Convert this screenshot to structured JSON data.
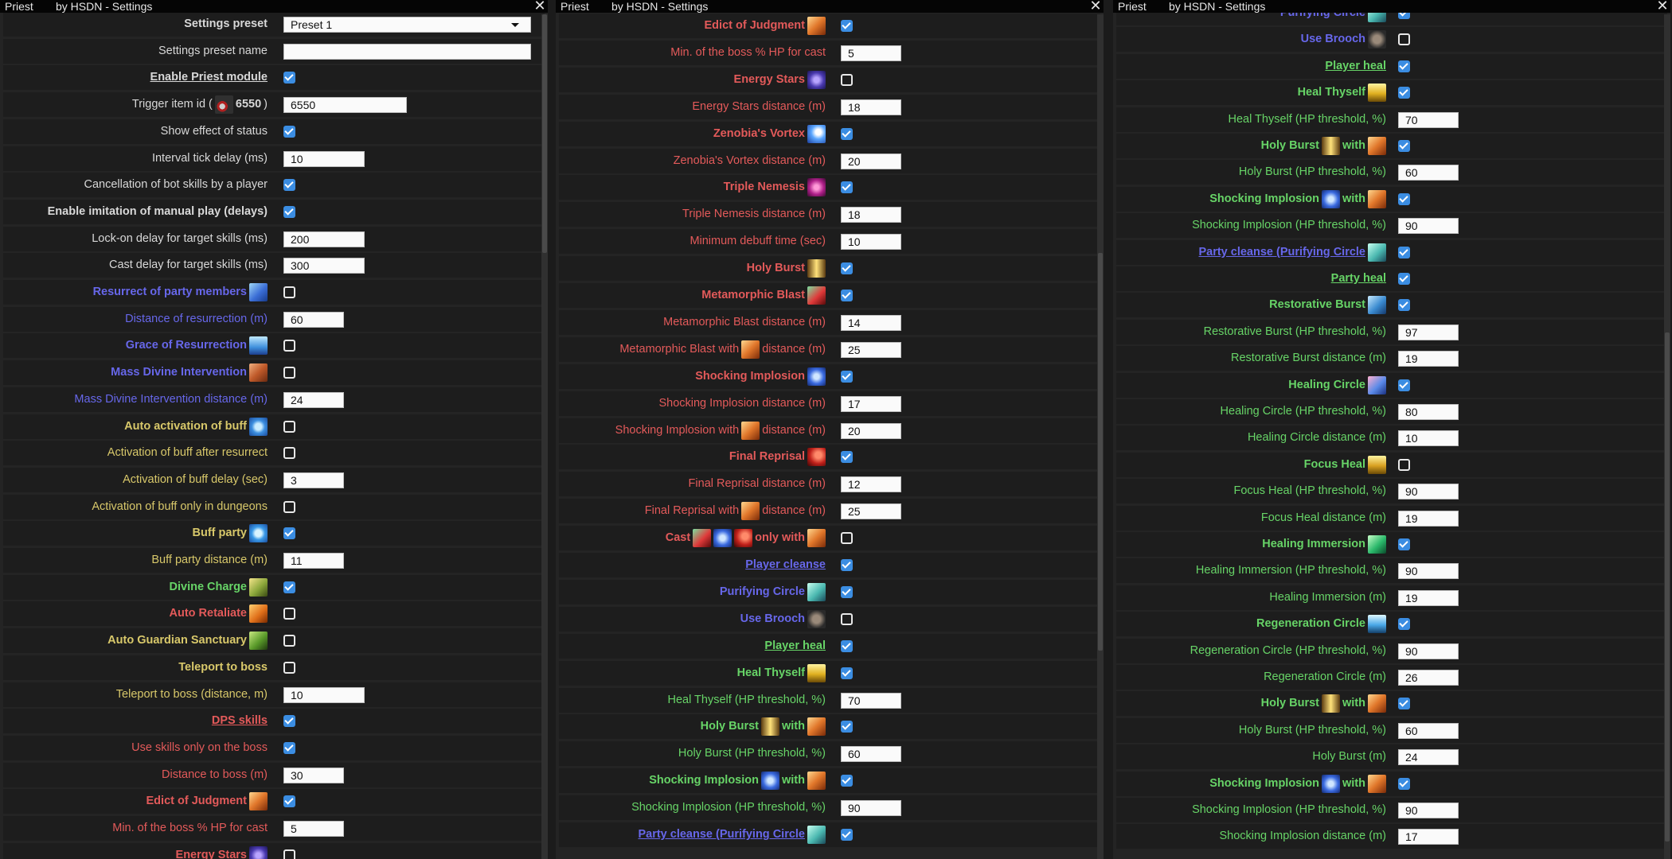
{
  "panels": [
    {
      "title": "Priest",
      "subtitle": "by HSDN - Settings",
      "rows": [
        {
          "label": "Settings preset",
          "color": "w",
          "bold": true,
          "select": "Preset 1"
        },
        {
          "label": "Settings preset name",
          "color": "w",
          "input": ""
        },
        {
          "label": "Enable Priest module",
          "color": "w",
          "bold": true,
          "underline": true,
          "check": true
        },
        {
          "label": "Trigger item id (",
          "color": "w",
          "icons": [
            "item-icon"
          ],
          "after": "6550)",
          "after_bold": "6550",
          "input": "6550"
        },
        {
          "label": "Show effect of status",
          "color": "w",
          "check": true
        },
        {
          "label": "Interval tick delay (ms)",
          "color": "w",
          "input": "10"
        },
        {
          "label": "Cancellation of bot skills by a player",
          "color": "w",
          "check": true
        },
        {
          "label": "Enable imitation of manual play (delays)",
          "color": "w",
          "bold": true,
          "check": true
        },
        {
          "label": "Lock-on delay for target skills (ms)",
          "color": "w",
          "input": "200"
        },
        {
          "label": "Cast delay for target skills (ms)",
          "color": "w",
          "input": "300"
        },
        {
          "label": "Resurrect of party members",
          "color": "b",
          "bold": true,
          "icons": [
            "resurrect-icon"
          ],
          "check": false
        },
        {
          "label": "Distance of resurrection (m)",
          "color": "b",
          "input": "60"
        },
        {
          "label": "Grace of Resurrection",
          "color": "b",
          "bold": true,
          "icons": [
            "grace-resurrection-icon"
          ],
          "check": false
        },
        {
          "label": "Mass Divine Intervention",
          "color": "b",
          "bold": true,
          "icons": [
            "mass-divine-intervention-icon"
          ],
          "check": false
        },
        {
          "label": "Mass Divine Intervention distance (m)",
          "color": "b",
          "input": "24"
        },
        {
          "label": "Auto activation of buff",
          "color": "y",
          "bold": true,
          "icons": [
            "buff-icon"
          ],
          "check": false
        },
        {
          "label": "Activation of buff after resurrect",
          "color": "y",
          "check": false
        },
        {
          "label": "Activation of buff delay (sec)",
          "color": "y",
          "input": "3"
        },
        {
          "label": "Activation of buff only in dungeons",
          "color": "y",
          "check": false
        },
        {
          "label": "Buff party",
          "color": "y",
          "bold": true,
          "icons": [
            "buff-party-icon"
          ],
          "check": true
        },
        {
          "label": "Buff party distance (m)",
          "color": "y",
          "input": "11"
        },
        {
          "label": "Divine Charge",
          "color": "g",
          "bold": true,
          "icons": [
            "divine-charge-icon"
          ],
          "check": true
        },
        {
          "label": "Auto Retaliate",
          "color": "r",
          "bold": true,
          "icons": [
            "auto-retaliate-icon"
          ],
          "check": false
        },
        {
          "label": "Auto Guardian Sanctuary",
          "color": "y",
          "bold": true,
          "icons": [
            "guardian-sanctuary-icon"
          ],
          "check": false
        },
        {
          "label": "Teleport to boss",
          "color": "y",
          "bold": true,
          "check": false
        },
        {
          "label": "Teleport to boss (distance, m)",
          "color": "y",
          "input": "10"
        },
        {
          "label": "DPS skills",
          "color": "r",
          "bold": true,
          "underline": true,
          "check": true
        },
        {
          "label": "Use skills only on the boss",
          "color": "r",
          "check": true
        },
        {
          "label": "Distance to boss (m)",
          "color": "r",
          "input": "30"
        },
        {
          "label": "Edict of Judgment",
          "color": "r",
          "bold": true,
          "icons": [
            "edict-judgment-icon"
          ],
          "check": true
        },
        {
          "label": "Min. of the boss % HP for cast",
          "color": "r",
          "input": "5"
        },
        {
          "label": "Energy Stars",
          "color": "r",
          "bold": true,
          "icons": [
            "energy-stars-icon"
          ],
          "check": false
        }
      ]
    },
    {
      "title": "Priest",
      "subtitle": "by HSDN - Settings",
      "rows": [
        {
          "label": "Edict of Judgment",
          "color": "r",
          "bold": true,
          "icons": [
            "edict-judgment-icon"
          ],
          "check": true
        },
        {
          "label": "Min. of the boss % HP for cast",
          "color": "r",
          "input": "5"
        },
        {
          "label": "Energy Stars",
          "color": "r",
          "bold": true,
          "icons": [
            "energy-stars-icon"
          ],
          "check": false
        },
        {
          "label": "Energy Stars distance (m)",
          "color": "r",
          "input": "18"
        },
        {
          "label": "Zenobia's Vortex",
          "color": "r",
          "bold": true,
          "icons": [
            "zenobia-vortex-icon"
          ],
          "check": true
        },
        {
          "label": "Zenobia's Vortex distance (m)",
          "color": "r",
          "input": "20"
        },
        {
          "label": "Triple Nemesis",
          "color": "r",
          "bold": true,
          "icons": [
            "triple-nemesis-icon"
          ],
          "check": true
        },
        {
          "label": "Triple Nemesis distance (m)",
          "color": "r",
          "input": "18"
        },
        {
          "label": "Minimum debuff time (sec)",
          "color": "r",
          "input": "10"
        },
        {
          "label": "Holy Burst",
          "color": "r",
          "bold": true,
          "icons": [
            "holy-burst-icon"
          ],
          "check": true
        },
        {
          "label": "Metamorphic Blast",
          "color": "r",
          "bold": true,
          "icons": [
            "metamorphic-blast-icon"
          ],
          "check": true
        },
        {
          "label": "Metamorphic Blast distance (m)",
          "color": "r",
          "input": "14"
        },
        {
          "label": "Metamorphic Blast with",
          "color": "r",
          "icons": [
            "edict-judgment-icon"
          ],
          "after": "distance (m)",
          "input": "25"
        },
        {
          "label": "Shocking Implosion",
          "color": "r",
          "bold": true,
          "icons": [
            "shocking-implosion-icon"
          ],
          "check": true
        },
        {
          "label": "Shocking Implosion distance (m)",
          "color": "r",
          "input": "17"
        },
        {
          "label": "Shocking Implosion with",
          "color": "r",
          "icons": [
            "edict-judgment-icon"
          ],
          "after": "distance (m)",
          "input": "20"
        },
        {
          "label": "Final Reprisal",
          "color": "r",
          "bold": true,
          "icons": [
            "final-reprisal-icon"
          ],
          "check": true
        },
        {
          "label": "Final Reprisal distance (m)",
          "color": "r",
          "input": "12"
        },
        {
          "label": "Final Reprisal with",
          "color": "r",
          "icons": [
            "edict-judgment-icon"
          ],
          "after": "distance (m)",
          "input": "25"
        },
        {
          "label": "Cast",
          "color": "r",
          "bold": true,
          "icons": [
            "metamorphic-blast-icon",
            "shocking-implosion-icon",
            "final-reprisal-icon"
          ],
          "after": "only with",
          "after_icons": [
            "edict-judgment-icon"
          ],
          "check": false
        },
        {
          "label": "Player cleanse",
          "color": "b",
          "bold": true,
          "underline": true,
          "check": true
        },
        {
          "label": "Purifying Circle",
          "color": "b",
          "bold": true,
          "icons": [
            "purifying-circle-icon"
          ],
          "check": true
        },
        {
          "label": "Use Brooch",
          "color": "b",
          "bold": true,
          "icons": [
            "brooch-icon"
          ],
          "check": false
        },
        {
          "label": "Player heal",
          "color": "g",
          "bold": true,
          "underline": true,
          "check": true
        },
        {
          "label": "Heal Thyself",
          "color": "g",
          "bold": true,
          "icons": [
            "heal-thyself-icon"
          ],
          "check": true
        },
        {
          "label": "Heal Thyself (HP threshold, %)",
          "color": "g",
          "input": "70"
        },
        {
          "label": "Holy Burst",
          "color": "g",
          "bold": true,
          "icons": [
            "holy-burst-icon"
          ],
          "after": "with",
          "after_icons": [
            "edict-judgment-icon"
          ],
          "check": true
        },
        {
          "label": "Holy Burst (HP threshold, %)",
          "color": "g",
          "input": "60"
        },
        {
          "label": "Shocking Implosion",
          "color": "g",
          "bold": true,
          "icons": [
            "shocking-implosion-icon"
          ],
          "after": "with",
          "after_icons": [
            "edict-judgment-icon"
          ],
          "check": true
        },
        {
          "label": "Shocking Implosion (HP threshold, %)",
          "color": "g",
          "input": "90"
        },
        {
          "label": "Party cleanse (Purifying Circle",
          "color": "b",
          "bold": true,
          "underline": true,
          "icons": [
            "purifying-circle-icon"
          ],
          "check": true
        }
      ]
    },
    {
      "title": "Priest",
      "subtitle": "by HSDN - Settings",
      "rows": [
        {
          "label": "Purifying Circle",
          "color": "b",
          "bold": true,
          "icons": [
            "purifying-circle-icon"
          ],
          "check": true
        },
        {
          "label": "Use Brooch",
          "color": "b",
          "bold": true,
          "icons": [
            "brooch-icon"
          ],
          "check": false
        },
        {
          "label": "Player heal",
          "color": "g",
          "bold": true,
          "underline": true,
          "check": true
        },
        {
          "label": "Heal Thyself",
          "color": "g",
          "bold": true,
          "icons": [
            "heal-thyself-icon"
          ],
          "check": true
        },
        {
          "label": "Heal Thyself (HP threshold, %)",
          "color": "g",
          "input": "70"
        },
        {
          "label": "Holy Burst",
          "color": "g",
          "bold": true,
          "icons": [
            "holy-burst-icon"
          ],
          "after": "with",
          "after_icons": [
            "edict-judgment-icon"
          ],
          "check": true
        },
        {
          "label": "Holy Burst (HP threshold, %)",
          "color": "g",
          "input": "60"
        },
        {
          "label": "Shocking Implosion",
          "color": "g",
          "bold": true,
          "icons": [
            "shocking-implosion-icon"
          ],
          "after": "with",
          "after_icons": [
            "edict-judgment-icon"
          ],
          "check": true
        },
        {
          "label": "Shocking Implosion (HP threshold, %)",
          "color": "g",
          "input": "90"
        },
        {
          "label": "Party cleanse (Purifying Circle",
          "color": "b",
          "bold": true,
          "underline": true,
          "icons": [
            "purifying-circle-icon"
          ],
          "check": true
        },
        {
          "label": "Party heal",
          "color": "g",
          "bold": true,
          "underline": true,
          "check": true
        },
        {
          "label": "Restorative Burst",
          "color": "g",
          "bold": true,
          "icons": [
            "restorative-burst-icon"
          ],
          "check": true
        },
        {
          "label": "Restorative Burst (HP threshold, %)",
          "color": "g",
          "input": "97"
        },
        {
          "label": "Restorative Burst distance (m)",
          "color": "g",
          "input": "19"
        },
        {
          "label": "Healing Circle",
          "color": "g",
          "bold": true,
          "icons": [
            "healing-circle-icon"
          ],
          "check": true
        },
        {
          "label": "Healing Circle (HP threshold, %)",
          "color": "g",
          "input": "80"
        },
        {
          "label": "Healing Circle distance (m)",
          "color": "g",
          "input": "10"
        },
        {
          "label": "Focus Heal",
          "color": "g",
          "bold": true,
          "icons": [
            "focus-heal-icon"
          ],
          "check": false
        },
        {
          "label": "Focus Heal (HP threshold, %)",
          "color": "g",
          "input": "90"
        },
        {
          "label": "Focus Heal distance (m)",
          "color": "g",
          "input": "19"
        },
        {
          "label": "Healing Immersion",
          "color": "g",
          "bold": true,
          "icons": [
            "healing-immersion-icon"
          ],
          "check": true
        },
        {
          "label": "Healing Immersion (HP threshold, %)",
          "color": "g",
          "input": "90"
        },
        {
          "label": "Healing Immersion (m)",
          "color": "g",
          "input": "19"
        },
        {
          "label": "Regeneration Circle",
          "color": "g",
          "bold": true,
          "icons": [
            "regeneration-circle-icon"
          ],
          "check": true
        },
        {
          "label": "Regeneration Circle (HP threshold, %)",
          "color": "g",
          "input": "90"
        },
        {
          "label": "Regeneration Circle (m)",
          "color": "g",
          "input": "26"
        },
        {
          "label": "Holy Burst",
          "color": "g",
          "bold": true,
          "icons": [
            "holy-burst-icon"
          ],
          "after": "with",
          "after_icons": [
            "edict-judgment-icon"
          ],
          "check": true
        },
        {
          "label": "Holy Burst (HP threshold, %)",
          "color": "g",
          "input": "60"
        },
        {
          "label": "Holy Burst (m)",
          "color": "g",
          "input": "24"
        },
        {
          "label": "Shocking Implosion",
          "color": "g",
          "bold": true,
          "icons": [
            "shocking-implosion-icon"
          ],
          "after": "with",
          "after_icons": [
            "edict-judgment-icon"
          ],
          "check": true
        },
        {
          "label": "Shocking Implosion (HP threshold, %)",
          "color": "g",
          "input": "90"
        },
        {
          "label": "Shocking Implosion distance (m)",
          "color": "g",
          "input": "17"
        }
      ]
    }
  ],
  "colors": {
    "checkbox_on": "#3b8de2",
    "label_white": "#d8d8d8",
    "label_red": "#e35a5a",
    "label_blue": "#6767ea",
    "label_yellow": "#d8c86a",
    "label_green": "#67d467"
  }
}
